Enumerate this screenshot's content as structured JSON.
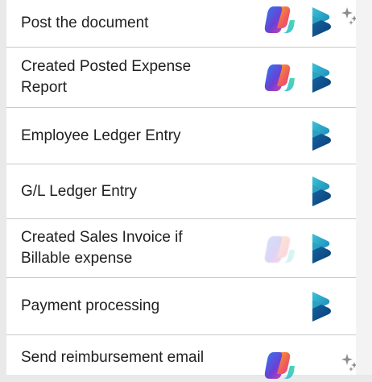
{
  "steps": [
    {
      "label": "Post the document",
      "copilot": "full",
      "dynamics": true,
      "sparkle": true
    },
    {
      "label": "Created Posted Expense\nReport",
      "copilot": "full",
      "dynamics": true,
      "sparkle": false
    },
    {
      "label": "Employee Ledger Entry",
      "copilot": "none",
      "dynamics": true,
      "sparkle": false
    },
    {
      "label": "G/L Ledger Entry",
      "copilot": "none",
      "dynamics": true,
      "sparkle": false
    },
    {
      "label": "Created Sales Invoice if\nBillable expense",
      "copilot": "faded",
      "dynamics": true,
      "sparkle": false
    },
    {
      "label": "Payment processing",
      "copilot": "none",
      "dynamics": true,
      "sparkle": false
    },
    {
      "label": "Send reimbursement email",
      "copilot": "full",
      "dynamics": false,
      "sparkle": true
    }
  ],
  "icons": {
    "copilot": "copilot-icon",
    "dynamics": "dynamics-365-icon",
    "sparkle": "ai-sparkle-icon"
  },
  "colors": {
    "copilot_orange": "#f5a623",
    "copilot_purple": "#6b3fd6",
    "copilot_blue": "#2f7dea",
    "copilot_pink": "#e8409c",
    "dynamics_dark": "#0b3f73",
    "dynamics_teal": "#2fb3c9",
    "sparkle_gray": "#8d8d90"
  }
}
